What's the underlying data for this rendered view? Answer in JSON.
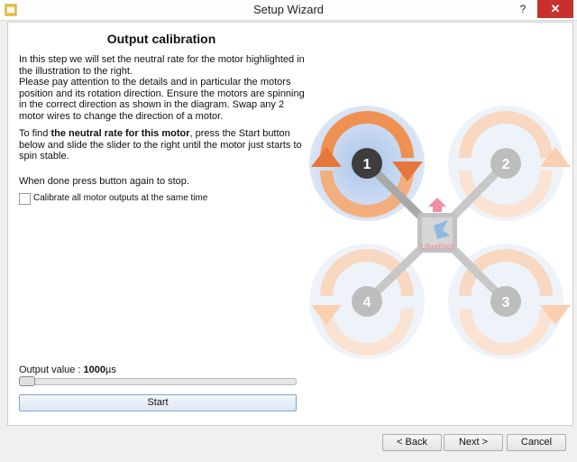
{
  "window": {
    "title": "Setup Wizard",
    "help_label": "?",
    "close_label": "✕"
  },
  "page": {
    "heading": "Output calibration",
    "intro": "In this step we will set the neutral rate for the motor highlighted in the illustration to the right.\nPlease pay attention to the details and in particular the motors position and its rotation direction. Ensure the motors are spinning in the correct direction as shown in the diagram. Swap any 2 motor wires to change the direction of a motor.",
    "instructions": {
      "prefix": "To find ",
      "bold": "the neutral rate for this motor",
      "suffix": ", press the Start button below and slide the slider to the right until the motor just starts to spin stable."
    },
    "done_text": "When done press button again to stop.",
    "calibrate_all_label": "Calibrate all motor outputs at the same time",
    "output_label": "Output value : ",
    "output_value": "1000",
    "output_unit": "µs",
    "slider_fraction": 0.0,
    "start_label": "Start"
  },
  "diagram": {
    "motors": [
      "1",
      "2",
      "3",
      "4"
    ],
    "highlighted_motor": "1",
    "logo_text": "LibrePilot",
    "colors": {
      "highlight_ring": "#c9d8ee",
      "rotor_highlight": "#ef8c4a",
      "rotor_dim": "#f8d8c0",
      "arm": "#bdbdbd"
    }
  },
  "footer": {
    "back_label": "< Back",
    "next_label": "Next >",
    "cancel_label": "Cancel"
  }
}
